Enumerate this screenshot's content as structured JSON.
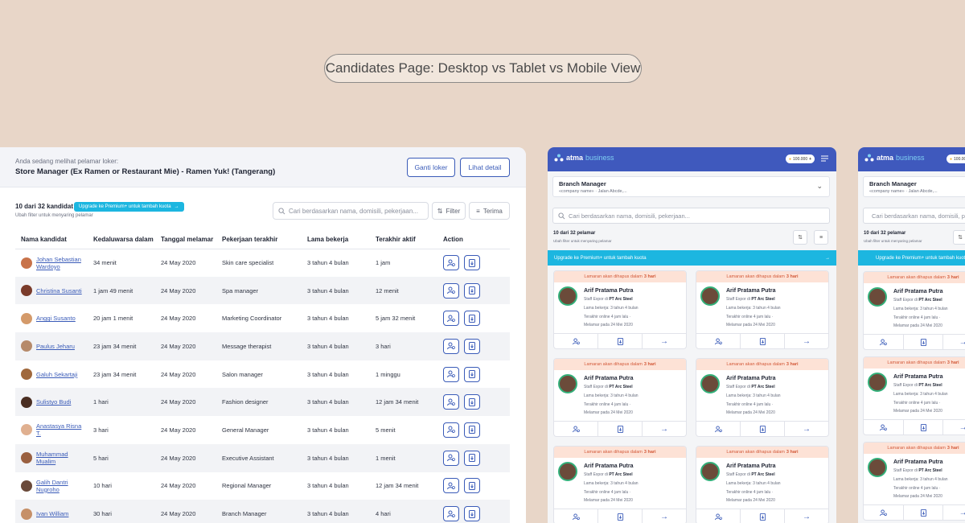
{
  "headline": "Candidates Page: Desktop vs Tablet vs Mobile View",
  "desktop": {
    "viewing_text": "Anda sedang melihat pelamar loker:",
    "job_title": "Store Manager (Ex Ramen or Restaurant Mie) - Ramen Yuk! (Tangerang)",
    "btn_change": "Ganti loker",
    "btn_detail": "Lihat detail",
    "count": "10 dari 32 kandidat",
    "upgrade": "Upgrade ke Premium+ untuk tambah kuota",
    "hint": "Ubah filter untuk menyaring pelamar",
    "search_placeholder": "Cari berdasarkan nama, domisili, pekerjaan...",
    "filter": "Filter",
    "received": "Terima",
    "columns": [
      "Nama kandidat",
      "Kedaluwarsa dalam",
      "Tanggal melamar",
      "Pekerjaan terakhir",
      "Lama bekerja",
      "Terakhir aktif",
      "Action"
    ],
    "rows": [
      {
        "name": "Johan Sebastian Wardoyo",
        "expires": "34 menit",
        "date": "24 May 2020",
        "job": "Skin care specialist",
        "duration": "3 tahun 4 bulan",
        "active": "1 jam"
      },
      {
        "name": "Christina Susanti",
        "expires": "1 jam 49 menit",
        "date": "24 May 2020",
        "job": "Spa manager",
        "duration": "3 tahun 4 bulan",
        "active": "12 menit"
      },
      {
        "name": "Anggi Susanto",
        "expires": "20 jam 1 menit",
        "date": "24 May 2020",
        "job": "Marketing Coordinator",
        "duration": "3 tahun 4 bulan",
        "active": "5 jam 32 menit"
      },
      {
        "name": "Paulus Jeharu",
        "expires": "23 jam 34 menit",
        "date": "24 May 2020",
        "job": "Message therapist",
        "duration": "3 tahun 4 bulan",
        "active": "3 hari"
      },
      {
        "name": "Galuh Sekartaji",
        "expires": "23 jam 34 menit",
        "date": "24 May 2020",
        "job": "Salon manager",
        "duration": "3 tahun 4 bulan",
        "active": "1 minggu"
      },
      {
        "name": "Sulistyo Budi",
        "expires": "1 hari",
        "date": "24 May 2020",
        "job": "Fashion designer",
        "duration": "3 tahun 4 bulan",
        "active": "12 jam 34 menit"
      },
      {
        "name": "Anastasya Risna T.",
        "expires": "3 hari",
        "date": "24 May 2020",
        "job": "General Manager",
        "duration": "3 tahun 4 bulan",
        "active": "5 menit"
      },
      {
        "name": "Muhammad Mualim",
        "expires": "5 hari",
        "date": "24 May 2020",
        "job": "Executive Assistant",
        "duration": "3 tahun 4 bulan",
        "active": "1 menit"
      },
      {
        "name": "Galih Dantri Nugroho",
        "expires": "10 hari",
        "date": "24 May 2020",
        "job": "Regional Manager",
        "duration": "3 tahun 4 bulan",
        "active": "12 jam 34 menit"
      },
      {
        "name": "Ivan William",
        "expires": "30 hari",
        "date": "24 May 2020",
        "job": "Branch Manager",
        "duration": "3 tahun 4 bulan",
        "active": "4 hari"
      }
    ]
  },
  "mobile": {
    "logo_a": "atma",
    "logo_b": "business",
    "coins": "100.000",
    "job_title": "Branch Manager",
    "job_sub": "«company name» · Jalan Abcde,...",
    "search_placeholder": "Cari berdasarkan nama, domisili, pekerjaan...",
    "count": "10 dari 32 pelamar",
    "hint": "Ubah filter untuk menyaring pelamar",
    "upgrade": "Upgrade ke Premium+ untuk tambah kuota",
    "card": {
      "warn": "Lamaran akan dihapus dalam",
      "warn_days": "3 hari",
      "name": "Arif Pratama Putra",
      "role_prefix": "Staff Expor di",
      "company": "PT Arc Steel",
      "exp": "Lama bekerja: 3 tahun 4 bulan",
      "online": "Terakhir online 4 jam lalu ·",
      "applied": "Melamar pada 24 Mei 2020"
    }
  },
  "colors": {
    "brand": "#3f59bd",
    "accent": "#1cb6e0",
    "link": "#3a5bb8",
    "warn": "#d35a3a"
  }
}
